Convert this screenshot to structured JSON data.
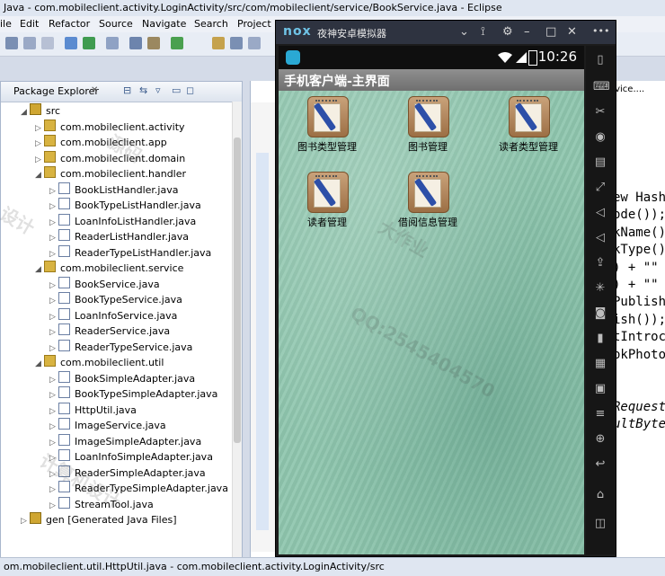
{
  "window": {
    "title": "Java - com.mobileclient.activity.LoginActivity/src/com/mobileclient/service/BookService.java - Eclipse"
  },
  "menu": [
    "ile",
    "Edit",
    "Refactor",
    "Source",
    "Navigate",
    "Search",
    "Project"
  ],
  "package_explorer": {
    "title": "Package Explorer",
    "tree": [
      {
        "label": "src",
        "icon": "src-folder-icon",
        "depth": 0,
        "expanded": true
      },
      {
        "label": "com.mobileclient.activity",
        "icon": "package-icon",
        "depth": 1,
        "expanded": false
      },
      {
        "label": "com.mobileclient.app",
        "icon": "package-icon",
        "depth": 1,
        "expanded": false
      },
      {
        "label": "com.mobileclient.domain",
        "icon": "package-icon",
        "depth": 1,
        "expanded": false
      },
      {
        "label": "com.mobileclient.handler",
        "icon": "package-icon",
        "depth": 1,
        "expanded": true
      },
      {
        "label": "BookListHandler.java",
        "icon": "java-file-icon",
        "depth": 2,
        "expanded": false
      },
      {
        "label": "BookTypeListHandler.java",
        "icon": "java-file-icon",
        "depth": 2,
        "expanded": false
      },
      {
        "label": "LoanInfoListHandler.java",
        "icon": "java-file-icon",
        "depth": 2,
        "expanded": false
      },
      {
        "label": "ReaderListHandler.java",
        "icon": "java-file-icon",
        "depth": 2,
        "expanded": false
      },
      {
        "label": "ReaderTypeListHandler.java",
        "icon": "java-file-icon",
        "depth": 2,
        "expanded": false
      },
      {
        "label": "com.mobileclient.service",
        "icon": "package-icon",
        "depth": 1,
        "expanded": true
      },
      {
        "label": "BookService.java",
        "icon": "java-file-icon",
        "depth": 2,
        "expanded": false
      },
      {
        "label": "BookTypeService.java",
        "icon": "java-file-icon",
        "depth": 2,
        "expanded": false
      },
      {
        "label": "LoanInfoService.java",
        "icon": "java-file-icon",
        "depth": 2,
        "expanded": false
      },
      {
        "label": "ReaderService.java",
        "icon": "java-file-icon",
        "depth": 2,
        "expanded": false
      },
      {
        "label": "ReaderTypeService.java",
        "icon": "java-file-icon",
        "depth": 2,
        "expanded": false
      },
      {
        "label": "com.mobileclient.util",
        "icon": "package-icon",
        "depth": 1,
        "expanded": true
      },
      {
        "label": "BookSimpleAdapter.java",
        "icon": "java-file-icon",
        "depth": 2,
        "expanded": false
      },
      {
        "label": "BookTypeSimpleAdapter.java",
        "icon": "java-file-icon",
        "depth": 2,
        "expanded": false
      },
      {
        "label": "HttpUtil.java",
        "icon": "java-file-icon",
        "depth": 2,
        "expanded": false
      },
      {
        "label": "ImageService.java",
        "icon": "java-file-icon",
        "depth": 2,
        "expanded": false
      },
      {
        "label": "ImageSimpleAdapter.java",
        "icon": "java-file-icon",
        "depth": 2,
        "expanded": false
      },
      {
        "label": "LoanInfoSimpleAdapter.java",
        "icon": "java-file-icon",
        "depth": 2,
        "expanded": false
      },
      {
        "label": "ReaderSimpleAdapter.java",
        "icon": "java-file-icon",
        "depth": 2,
        "expanded": false
      },
      {
        "label": "ReaderTypeSimpleAdapter.java",
        "icon": "java-file-icon",
        "depth": 2,
        "expanded": false
      },
      {
        "label": "StreamTool.java",
        "icon": "java-file-icon",
        "depth": 2,
        "expanded": false
      },
      {
        "label": "gen [Generated Java Files]",
        "icon": "src-folder-icon",
        "depth": 0,
        "expanded": false
      }
    ]
  },
  "editor": {
    "tab_label": "rvice....",
    "code_lines": [
      "ew Hash",
      "ode());",
      "kName()",
      "kType()",
      ") + \"\"",
      ") + \"\"",
      "Publish",
      "ish());",
      "tIntroc",
      "okPhoto",
      "",
      "",
      "Request",
      "ultByte"
    ]
  },
  "emulator": {
    "brand": "nox",
    "title": "夜神安卓模拟器",
    "time": "10:26",
    "app_title": "手机客户端-主界面",
    "menu_items": [
      {
        "label": "图书类型管理"
      },
      {
        "label": "图书管理"
      },
      {
        "label": "读者类型管理"
      },
      {
        "label": "读者管理"
      },
      {
        "label": "借阅信息管理"
      }
    ]
  },
  "status_bar": {
    "text": "om.mobileclient.util.HttpUtil.java - com.mobileclient.activity.LoginActivity/src"
  },
  "watermark": [
    "设计",
    "QQ:2545404570",
    "源码",
    "大作业",
    "计算机设计"
  ]
}
